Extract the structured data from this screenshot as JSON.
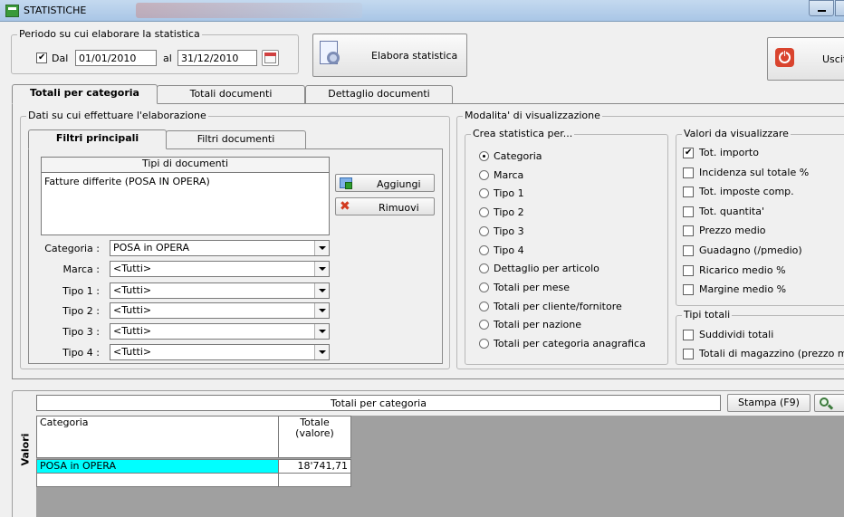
{
  "window": {
    "title": "STATISTICHE"
  },
  "period": {
    "legend": "Periodo su cui elaborare la statistica",
    "dal_label": "Dal",
    "dal_checked": true,
    "from_date": "01/01/2010",
    "al_label": "al",
    "to_date": "31/12/2010"
  },
  "toolbar": {
    "elabora_label": "Elabora statistica",
    "uscita_label": "Uscita"
  },
  "main_tabs": [
    "Totali per categoria",
    "Totali documenti",
    "Dettaglio documenti"
  ],
  "filters": {
    "legend": "Dati su cui effettuare l'elaborazione",
    "sub_tabs": [
      "Filtri principali",
      "Filtri documenti"
    ],
    "doc_types_header": "Tipi di documenti",
    "doc_types": [
      "Fatture differite (POSA IN OPERA)"
    ],
    "aggiungi_label": "Aggiungi",
    "rimuovi_label": "Rimuovi",
    "rows": [
      {
        "label": "Categoria :",
        "value": "POSA in OPERA"
      },
      {
        "label": "Marca :",
        "value": "<Tutti>"
      },
      {
        "label": "Tipo 1 :",
        "value": "<Tutti>"
      },
      {
        "label": "Tipo 2 :",
        "value": "<Tutti>"
      },
      {
        "label": "Tipo 3 :",
        "value": "<Tutti>"
      },
      {
        "label": "Tipo 4 :",
        "value": "<Tutti>"
      }
    ]
  },
  "modalita": {
    "legend": "Modalita' di visualizzazione",
    "crea_legend": "Crea statistica per...",
    "options": [
      "Categoria",
      "Marca",
      "Tipo 1",
      "Tipo 2",
      "Tipo 3",
      "Tipo 4",
      "Dettaglio per articolo",
      "Totali per mese",
      "Totali per cliente/fornitore",
      "Totali per nazione",
      "Totali per categoria anagrafica"
    ],
    "selected_index": 0,
    "valori_legend": "Valori da visualizzare",
    "valori": [
      {
        "label": "Tot. importo",
        "checked": true
      },
      {
        "label": "Incidenza sul totale %",
        "checked": false
      },
      {
        "label": "Tot. imposte comp.",
        "checked": false
      },
      {
        "label": "Tot. quantita'",
        "checked": false
      },
      {
        "label": "Prezzo medio",
        "checked": false
      },
      {
        "label": "Guadagno (/pmedio)",
        "checked": false
      },
      {
        "label": "Ricarico medio %",
        "checked": false
      },
      {
        "label": "Margine medio %",
        "checked": false
      }
    ],
    "tipi_legend": "Tipi totali",
    "tipi": [
      {
        "label": "Suddividi totali",
        "checked": false
      },
      {
        "label": "Totali di magazzino (prezzo medio)",
        "checked": false
      }
    ]
  },
  "results": {
    "side_label": "Valori",
    "title": "Totali per categoria",
    "stampa_label": "Stampa (F9)",
    "col_categoria": "Categoria",
    "col_totale_1": "Totale",
    "col_totale_2": "(valore)",
    "rows": [
      {
        "categoria": "POSA in OPERA",
        "totale": "18'741,71"
      }
    ],
    "selected_color": "#00ffff"
  }
}
